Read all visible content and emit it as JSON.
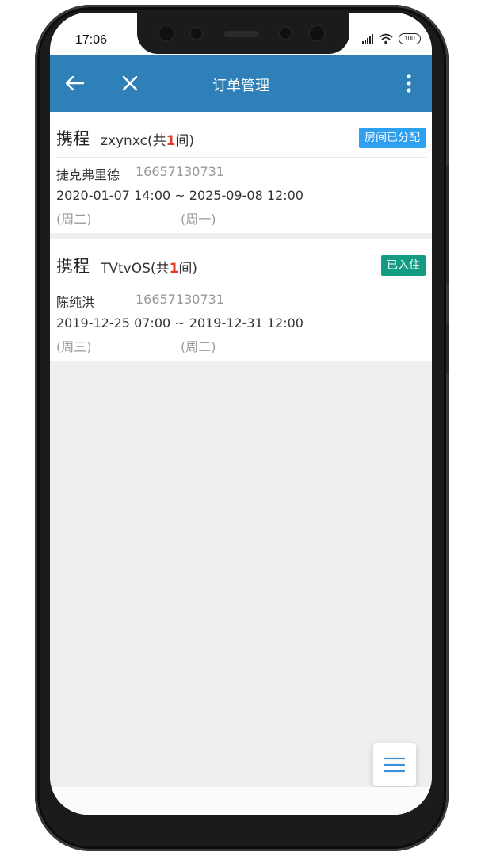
{
  "status_bar": {
    "time": "17:06",
    "battery": "100"
  },
  "appbar": {
    "title": "订单管理",
    "back_icon": "arrow-left-icon",
    "close_icon": "close-icon",
    "more_icon": "more-vertical-icon",
    "color": "#2f80b9"
  },
  "orders": [
    {
      "source": "携程",
      "hotel": "zxynxc",
      "count_prefix": "(共",
      "count": "1",
      "count_suffix": "间)",
      "status": "房间已分配",
      "status_color": "#2f9fef",
      "guest": "捷克弗里德",
      "phone": "16657130731",
      "dates": "2020-01-07 14:00 ~ 2025-09-08 12:00",
      "checkin_weekday": "(周二)",
      "checkout_weekday": "(周一)"
    },
    {
      "source": "携程",
      "hotel": "TVtvOS",
      "count_prefix": "(共",
      "count": "1",
      "count_suffix": "间)",
      "status": "已入住",
      "status_color": "#129c82",
      "guest": "陈纯洪",
      "phone": "16657130731",
      "dates": "2019-12-25 07:00 ~ 2019-12-31 12:00",
      "checkin_weekday": "(周三)",
      "checkout_weekday": "(周二)"
    }
  ],
  "fab": {
    "icon": "menu-icon"
  }
}
